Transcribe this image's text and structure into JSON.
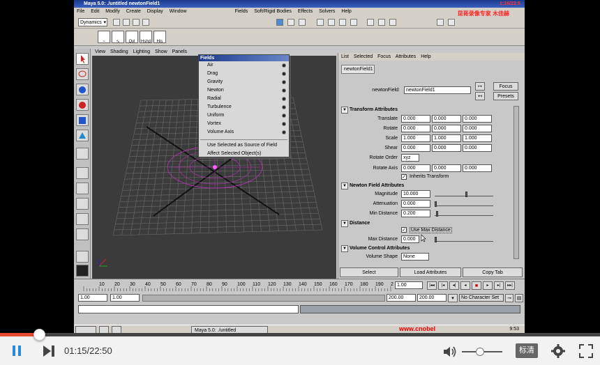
{
  "maya": {
    "window_title": "Maya 5.0: ./untitled   newtonField1",
    "top_timer": "1:16/22:5",
    "watermark_cn": "昆哥录像专家 木佳赫",
    "menu": [
      "File",
      "Edit",
      "Modify",
      "Create",
      "Display",
      "Window",
      "Fields",
      "Soft/Rigid Bodies",
      "Effects",
      "Solvers",
      "Help"
    ],
    "mode_select": "Dynamics",
    "shelf_icons": [
      "Ovl",
      "Hshd",
      "His"
    ],
    "viewport_menu": [
      "View",
      "Shading",
      "Lighting",
      "Show",
      "Panels"
    ],
    "fields_menu": {
      "title": "Fields",
      "items": [
        "Air",
        "Drag",
        "Gravity",
        "Newton",
        "Radial",
        "Turbulence",
        "Uniform",
        "Vortex",
        "Volume Axis"
      ],
      "extra": [
        "Use Selected as Source of Field",
        "Affect Selected Object(s)"
      ]
    },
    "attr_editor": {
      "menu": [
        "List",
        "Selected",
        "Focus",
        "Attributes",
        "Help"
      ],
      "tab": "newtonField1",
      "name_label": "newtonField:",
      "name_value": "newtonField1",
      "focus_btn": "Focus",
      "presets_btn": "Presets",
      "transform_header": "Transform Attributes",
      "translate_label": "Translate",
      "translate": [
        "0.000",
        "0.000",
        "0.000"
      ],
      "rotate_label": "Rotate",
      "rotate": [
        "0.000",
        "0.000",
        "0.000"
      ],
      "scale_label": "Scale",
      "scale": [
        "1.000",
        "1.000",
        "1.000"
      ],
      "shear_label": "Shear",
      "shear": [
        "0.000",
        "0.000",
        "0.000"
      ],
      "rotate_order_label": "Rotate Order",
      "rotate_order": "xyz",
      "rotate_axis_label": "Rotate Axis",
      "rotate_axis": [
        "0.000",
        "0.000",
        "0.000"
      ],
      "inherits_transform": "Inherits Transform",
      "newton_header": "Newton Field Attributes",
      "magnitude_label": "Magnitude",
      "magnitude": "10.000",
      "attenuation_label": "Attenuation",
      "attenuation": "0.000",
      "min_distance_label": "Min Distance",
      "min_distance": "0.200",
      "distance_header": "Distance",
      "use_max_distance": "Use Max Distance",
      "max_distance_label": "Max Distance",
      "max_distance": "0.000",
      "volume_header": "Volume Control Attributes",
      "volume_shape_label": "Volume Shape",
      "volume_shape": "None",
      "select_btn": "Select",
      "load_attrs_btn": "Load Attributes",
      "copy_tab_btn": "Copy Tab"
    },
    "timeline": {
      "ticks": [
        "10",
        "20",
        "30",
        "40",
        "50",
        "60",
        "70",
        "80",
        "90",
        "100",
        "110",
        "120",
        "130",
        "140",
        "150",
        "160",
        "170",
        "180",
        "190",
        "2"
      ],
      "current_frame": "1.00"
    },
    "range": {
      "start": "1.00",
      "playback_start": "1.00",
      "playback_end": "200.00",
      "end": "200.00",
      "character_set": "No Character Set"
    },
    "taskbar": {
      "item": "Maya 5.0: ./untitled",
      "url": "www.cnobel",
      "clock": "9:53"
    }
  },
  "player": {
    "time": "01:15/22:50",
    "progress": 0.065,
    "quality": "标清",
    "volume": 0.45
  }
}
